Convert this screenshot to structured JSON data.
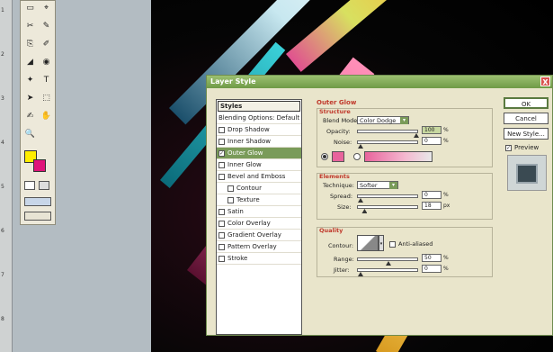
{
  "ruler": {
    "ticks": [
      "1",
      "2",
      "3",
      "4",
      "5",
      "6",
      "7",
      "8"
    ]
  },
  "toolbox": {
    "tools": [
      "▭",
      "⌖",
      "✂",
      "✎",
      "⎘",
      "✐",
      "◢",
      "◉",
      "✦",
      "T",
      "➤",
      "⬚",
      "✍",
      "✋",
      "🔍"
    ]
  },
  "dialog": {
    "title": "Layer Style",
    "close": "X",
    "styles_header": "Styles",
    "styles_items": [
      {
        "label": "Blending Options: Default",
        "checkbox": false,
        "selected": false,
        "sub": false
      },
      {
        "label": "Drop Shadow",
        "checkbox": true,
        "checked": false,
        "selected": false,
        "sub": false
      },
      {
        "label": "Inner Shadow",
        "checkbox": true,
        "checked": false,
        "selected": false,
        "sub": false
      },
      {
        "label": "Outer Glow",
        "checkbox": true,
        "checked": true,
        "selected": true,
        "sub": false
      },
      {
        "label": "Inner Glow",
        "checkbox": true,
        "checked": false,
        "selected": false,
        "sub": false
      },
      {
        "label": "Bevel and Emboss",
        "checkbox": true,
        "checked": false,
        "selected": false,
        "sub": false
      },
      {
        "label": "Contour",
        "checkbox": true,
        "checked": false,
        "selected": false,
        "sub": true
      },
      {
        "label": "Texture",
        "checkbox": true,
        "checked": false,
        "selected": false,
        "sub": true
      },
      {
        "label": "Satin",
        "checkbox": true,
        "checked": false,
        "selected": false,
        "sub": false
      },
      {
        "label": "Color Overlay",
        "checkbox": true,
        "checked": false,
        "selected": false,
        "sub": false
      },
      {
        "label": "Gradient Overlay",
        "checkbox": true,
        "checked": false,
        "selected": false,
        "sub": false
      },
      {
        "label": "Pattern Overlay",
        "checkbox": true,
        "checked": false,
        "selected": false,
        "sub": false
      },
      {
        "label": "Stroke",
        "checkbox": true,
        "checked": false,
        "selected": false,
        "sub": false
      }
    ],
    "outer_glow": {
      "title": "Outer Glow",
      "structure": {
        "title": "Structure",
        "blend_mode_label": "Blend Mode:",
        "blend_mode": "Color Dodge",
        "opacity_label": "Opacity:",
        "opacity": "100",
        "noise_label": "Noise:",
        "noise": "0",
        "pct": "%"
      },
      "elements": {
        "title": "Elements",
        "technique_label": "Technique:",
        "technique": "Softer",
        "spread_label": "Spread:",
        "spread": "0",
        "size_label": "Size:",
        "size": "18",
        "px": "px",
        "pct": "%"
      },
      "quality": {
        "title": "Quality",
        "contour_label": "Contour:",
        "anti_aliased": "Anti-aliased",
        "range_label": "Range:",
        "range": "50",
        "jitter_label": "Jitter:",
        "jitter": "0",
        "pct": "%"
      }
    },
    "buttons": {
      "ok": "OK",
      "cancel": "Cancel",
      "new_style": "New Style...",
      "preview": "Preview"
    },
    "colors": {
      "glow_color": "#e8649c",
      "accent": "#7a9b59"
    }
  }
}
